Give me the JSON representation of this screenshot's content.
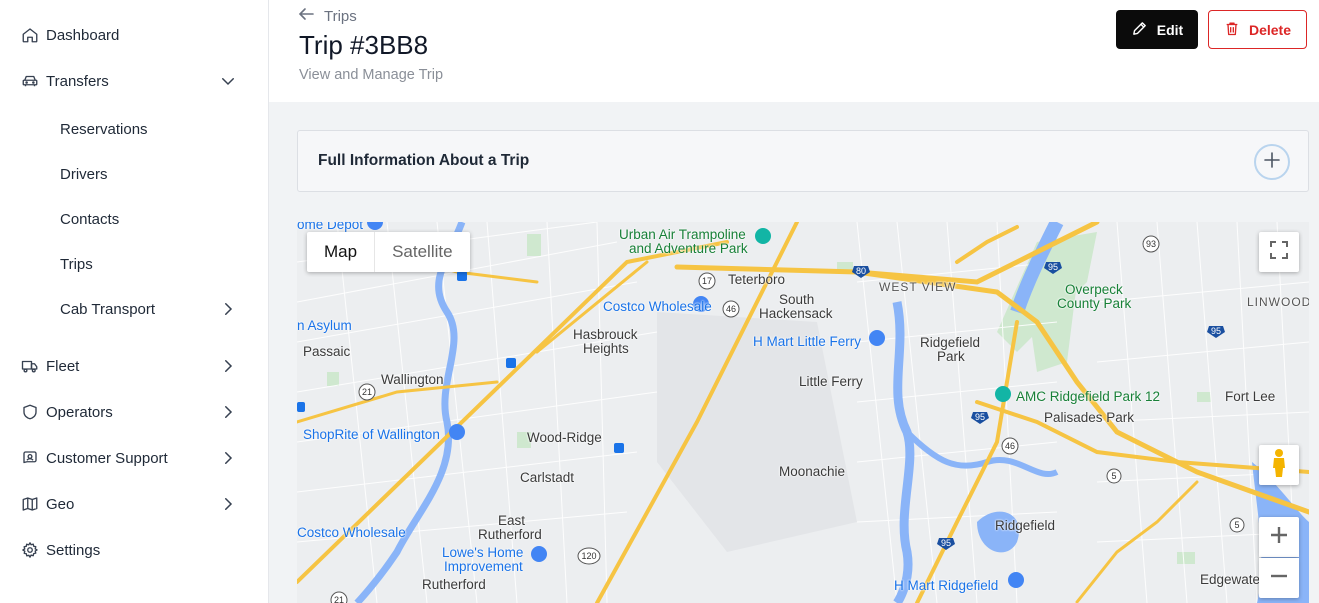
{
  "sidebar": {
    "items": [
      {
        "label": "Dashboard",
        "icon": "home-icon"
      },
      {
        "label": "Transfers",
        "icon": "car-icon",
        "expanded": true
      },
      {
        "label": "Fleet",
        "icon": "truck-icon"
      },
      {
        "label": "Operators",
        "icon": "shield-icon"
      },
      {
        "label": "Customer Support",
        "icon": "support-icon"
      },
      {
        "label": "Geo",
        "icon": "map-icon"
      },
      {
        "label": "Settings",
        "icon": "gear-icon"
      }
    ],
    "transfers_sub": [
      {
        "label": "Reservations"
      },
      {
        "label": "Drivers"
      },
      {
        "label": "Contacts"
      },
      {
        "label": "Trips"
      },
      {
        "label": "Cab Transport"
      }
    ]
  },
  "header": {
    "breadcrumb": "Trips",
    "title": "Trip #3BB8",
    "subtitle": "View and Manage Trip",
    "edit_label": "Edit",
    "delete_label": "Delete"
  },
  "info_panel": {
    "title": "Full Information About a Trip"
  },
  "map": {
    "type_map": "Map",
    "type_satellite": "Satellite",
    "labels": {
      "home_depot": "ome Depot",
      "urban_air": "Urban Air Trampoline",
      "urban_air_2": "and Adventure Park",
      "teterboro": "Teterboro",
      "west_view": "WEST VIEW",
      "overpeck": "Overpeck",
      "overpeck_2": "County Park",
      "linwood": "LINWOOD",
      "costco1": "Costco Wholesale",
      "south_hack": "South",
      "south_hack_2": "Hackensack",
      "hasbrouck": "Hasbrouck",
      "hasbrouck_2": "Heights",
      "asylum": "n Asylum",
      "passaic": "Passaic",
      "hmart1": "H Mart Little Ferry",
      "ridgefield_park": "Ridgefield",
      "ridgefield_park_2": "Park",
      "wallington": "Wallington",
      "little_ferry": "Little Ferry",
      "amc": "AMC Ridgefield Park 12",
      "fort_lee": "Fort Lee",
      "palisades": "Palisades Park",
      "shoprite": "ShopRite of Wallington",
      "wood_ridge": "Wood-Ridge",
      "moonachie": "Moonachie",
      "carlstadt": "Carlstadt",
      "east_rutherford": "East",
      "east_rutherford_2": "Rutherford",
      "costco2": "Costco Wholesale",
      "lowes": "Lowe's Home",
      "lowes_2": "Improvement",
      "ridgefield": "Ridgefield",
      "rutherford": "Rutherford",
      "hmart2": "H Mart Ridgefield",
      "edgewater": "Edgewater",
      "rt80": "80",
      "rt95a": "95",
      "rt95b": "95",
      "rt95c": "95",
      "rt95d": "95",
      "rt46a": "46",
      "rt46b": "46",
      "rt17": "17",
      "rt21a": "21",
      "rt21b": "21",
      "rt120": "120",
      "rt93": "93",
      "rt5a": "5",
      "rt5b": "5"
    }
  }
}
